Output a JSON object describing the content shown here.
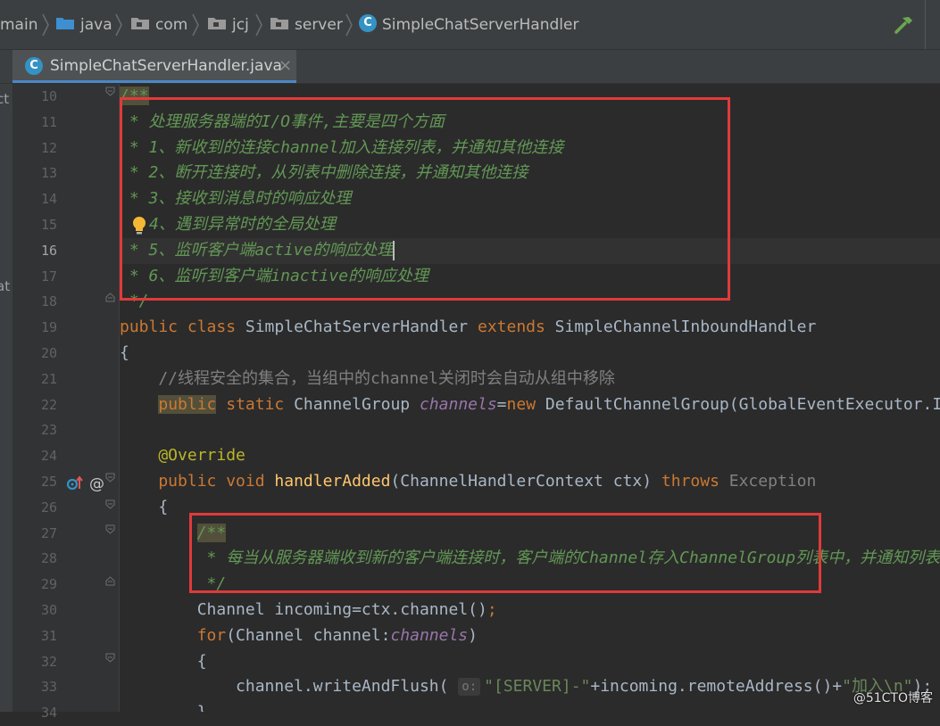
{
  "breadcrumb": {
    "items": [
      "main",
      "java",
      "com",
      "jcj",
      "server",
      "SimpleChatServerHandler"
    ]
  },
  "tab": {
    "label": "SimpleChatServerHandler.java",
    "close": "×"
  },
  "side_strip": {
    "labels": [
      "ct",
      "at"
    ]
  },
  "editor": {
    "current_line": 16,
    "line_numbers": [
      "10",
      "11",
      "12",
      "13",
      "14",
      "15",
      "16",
      "17",
      "18",
      "19",
      "20",
      "21",
      "22",
      "23",
      "24",
      "25",
      "26",
      "27",
      "28",
      "29",
      "30",
      "31",
      "32",
      "33",
      "34"
    ]
  },
  "code": {
    "l10": "/**",
    "l11": " * 处理服务器端的I/O事件,主要是四个方面",
    "l12": " * 1、新收到的连接channel加入连接列表，并通知其他连接",
    "l13": " * 2、断开连接时，从列表中删除连接，并通知其他连接",
    "l14": " * 3、接收到消息时的响应处理",
    "l15": "4、遇到异常时的全局处理",
    "l16": " * 5、监听客户端active的响应处理",
    "l17": " * 6、监听到客户端inactive的响应处理",
    "l18": " */",
    "l19": {
      "kw1": "public class",
      "name": " SimpleChatServerHandler ",
      "kw2": "extends",
      "base": " SimpleChannelInboundHandler"
    },
    "l20": "{",
    "l21": "    //线程安全的集合，当组中的channel关闭时会自动从组中移除",
    "l22": {
      "kw1": "public",
      "kw2": " static",
      "type": " ChannelGroup ",
      "field": "channels",
      "eq": "=",
      "kw3": "new",
      "rest": " DefaultChannelGroup(GlobalEventExecutor.INSTANCE);"
    },
    "l24": "    @Override",
    "l25": {
      "kw1": "    public void",
      "method": " handlerAdded",
      "params": "(ChannelHandlerContext ctx) ",
      "kw2": "throws",
      "exc": " Exception"
    },
    "l26": "    {",
    "l27": "/**",
    "l28": "         * 每当从服务器端收到新的客户端连接时，客户端的Channel存入ChannelGroup列表中，并通知列表中的其他客户端Channel",
    "l29": "         */",
    "l30": {
      "a": "        Channel incoming=ctx.channel()",
      "b": ";"
    },
    "l31": {
      "kw": "for",
      "a": "(Channel channel:",
      "field": "channels",
      "b": ")"
    },
    "l32": "        {",
    "l33": {
      "a": "            channel.writeAndFlush( ",
      "hint": "o:",
      "s1": "\"[SERVER]-\"",
      "b": "+incoming.remoteAddress()+",
      "s2": "\"加入\\n\"",
      "c": ");"
    },
    "l34": "        }"
  },
  "watermark": "@51CTO博客"
}
